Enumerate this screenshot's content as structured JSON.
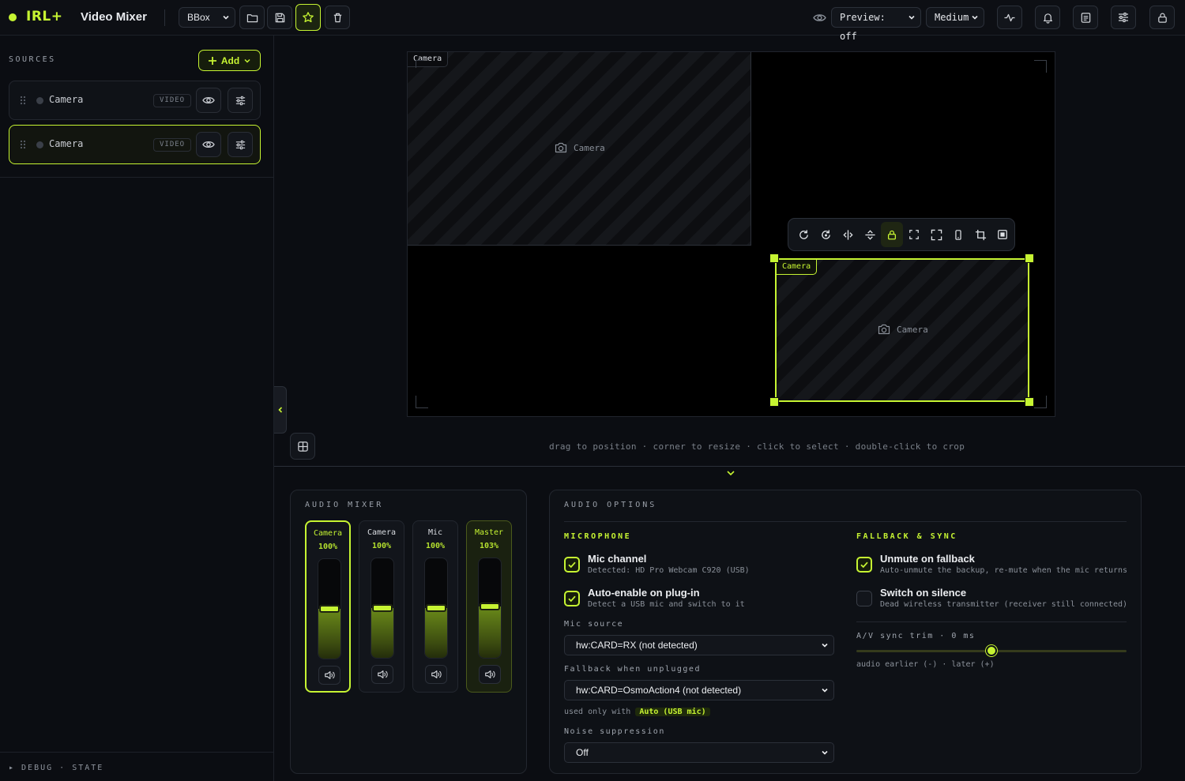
{
  "app": {
    "brand": "IRL+",
    "title": "Video Mixer",
    "scene_select": "BBox",
    "preview_select": "Preview: off",
    "quality_select": "Medium"
  },
  "sidebar": {
    "title": "SOURCES",
    "add_label": "Add",
    "sources": [
      {
        "name": "Camera",
        "badge": "VIDEO",
        "selected": false
      },
      {
        "name": "Camera",
        "badge": "VIDEO",
        "selected": true
      }
    ],
    "debug_label": "▸ DEBUG · STATE"
  },
  "stage": {
    "box1": {
      "label": "Camera",
      "center_label": "Camera"
    },
    "box2": {
      "label": "Camera",
      "center_label": "Camera"
    },
    "hint": "drag to position · corner to resize · click to select · double-click to crop"
  },
  "mixer": {
    "title": "AUDIO MIXER",
    "channels": [
      {
        "name": "Camera",
        "value": "100%",
        "level": 0.5
      },
      {
        "name": "Camera",
        "value": "100%",
        "level": 0.5
      },
      {
        "name": "Mic",
        "value": "100%",
        "level": 0.5
      },
      {
        "name": "Master",
        "value": "103%",
        "level": 0.515
      }
    ]
  },
  "options": {
    "title": "AUDIO OPTIONS",
    "microphone": {
      "title": "MICROPHONE",
      "mic_channel": {
        "title": "Mic channel",
        "sub": "Detected: HD Pro Webcam C920 (USB)",
        "checked": true
      },
      "auto_enable": {
        "title": "Auto-enable on plug-in",
        "sub": "Detect a USB mic and switch to it",
        "checked": true
      },
      "mic_source_label": "Mic source",
      "mic_source_value": "hw:CARD=RX (not detected)",
      "fallback_label": "Fallback when unplugged",
      "fallback_value": "hw:CARD=OsmoAction4 (not detected)",
      "used_only_prefix": "used only with",
      "used_only_chip": "Auto (USB mic)",
      "noise_label": "Noise suppression",
      "noise_value": "Off"
    },
    "fallback_sync": {
      "title": "FALLBACK & SYNC",
      "unmute": {
        "title": "Unmute on fallback",
        "sub": "Auto-unmute the backup, re-mute when the mic returns",
        "checked": true
      },
      "switch_silence": {
        "title": "Switch on silence",
        "sub": "Dead wireless transmitter (receiver still connected)",
        "checked": false
      },
      "av_label": "A/V sync trim · 0 ms",
      "av_hint": "audio earlier (-) · later (+)",
      "av_position": 0.5
    }
  }
}
